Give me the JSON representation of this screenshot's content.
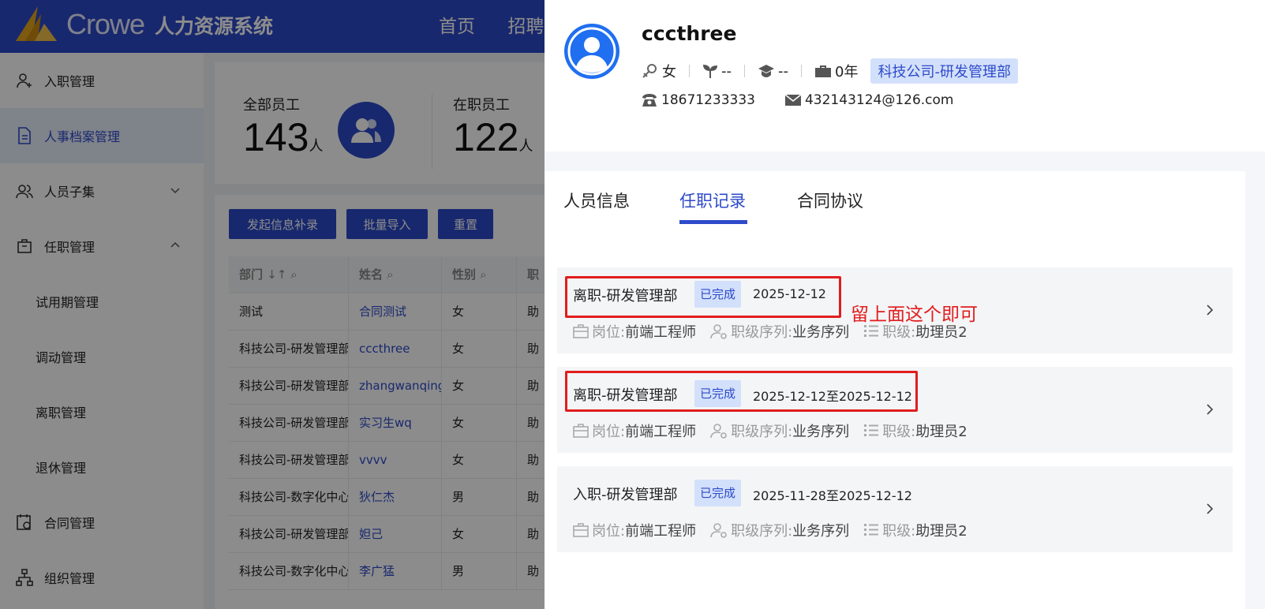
{
  "app": {
    "brand": "Crowe",
    "brand_sub": "人力资源系统",
    "nav": [
      "首页",
      "招聘"
    ]
  },
  "sidebar": {
    "items": [
      {
        "label": "入职管理",
        "icon": "user-add-icon"
      },
      {
        "label": "人事档案管理",
        "icon": "document-icon",
        "active": true
      },
      {
        "label": "人员子集",
        "icon": "users-icon",
        "expand": "down"
      },
      {
        "label": "任职管理",
        "icon": "briefcase-icon",
        "expand": "up"
      },
      {
        "label": "试用期管理"
      },
      {
        "label": "调动管理"
      },
      {
        "label": "离职管理"
      },
      {
        "label": "退休管理"
      },
      {
        "label": "合同管理",
        "icon": "contract-icon"
      },
      {
        "label": "组织管理",
        "icon": "org-icon"
      }
    ]
  },
  "stats": {
    "all_label": "全部员工",
    "all_count": "143",
    "active_label": "在职员工",
    "active_count": "122",
    "unit": "人"
  },
  "toolbar": {
    "btn_supplement": "发起信息补录",
    "btn_import": "批量导入",
    "btn_reset": "重置"
  },
  "table": {
    "headers": [
      "部门",
      "姓名",
      "性别",
      "职"
    ],
    "rows": [
      [
        "测试",
        "合同测试",
        "女",
        "助"
      ],
      [
        "科技公司-研发管理部",
        "cccthree",
        "女",
        "助"
      ],
      [
        "科技公司-研发管理部",
        "zhangwanqing",
        "女",
        "助"
      ],
      [
        "科技公司-研发管理部",
        "实习生wq",
        "女",
        "助"
      ],
      [
        "科技公司-研发管理部",
        "vvvv",
        "女",
        "助"
      ],
      [
        "科技公司-数字化中心",
        "狄仁杰",
        "男",
        "助"
      ],
      [
        "科技公司-研发管理部",
        "妲己",
        "女",
        "助"
      ],
      [
        "科技公司-数字化中心",
        "李广猛",
        "男",
        "助"
      ]
    ]
  },
  "profile": {
    "name": "cccthree",
    "gender": "女",
    "field2": "--",
    "education": "--",
    "tenure": "0年",
    "department": "科技公司-研发管理部",
    "phone": "18671233333",
    "email": "432143124@126.com"
  },
  "tabs": [
    "人员信息",
    "任职记录",
    "合同协议"
  ],
  "records": [
    {
      "title": "离职-研发管理部",
      "status": "已完成",
      "date": "2025-12-12",
      "position_label": "岗位:",
      "position": "前端工程师",
      "series_label": "职级序列:",
      "series": "业务序列",
      "level_label": "职级:",
      "level": "助理员2"
    },
    {
      "title": "离职-研发管理部",
      "status": "已完成",
      "date": "2025-12-12至2025-12-12",
      "position_label": "岗位:",
      "position": "前端工程师",
      "series_label": "职级序列:",
      "series": "业务序列",
      "level_label": "职级:",
      "level": "助理员2"
    },
    {
      "title": "入职-研发管理部",
      "status": "已完成",
      "date": "2025-11-28至2025-12-12",
      "position_label": "岗位:",
      "position": "前端工程师",
      "series_label": "职级序列:",
      "series": "业务序列",
      "level_label": "职级:",
      "level": "助理员2"
    }
  ],
  "annotation": {
    "note": "留上面这个即可",
    "color": "#e11d1d"
  },
  "colors": {
    "primary": "#2d4ac9",
    "tag_bg": "#d3e0fb"
  }
}
